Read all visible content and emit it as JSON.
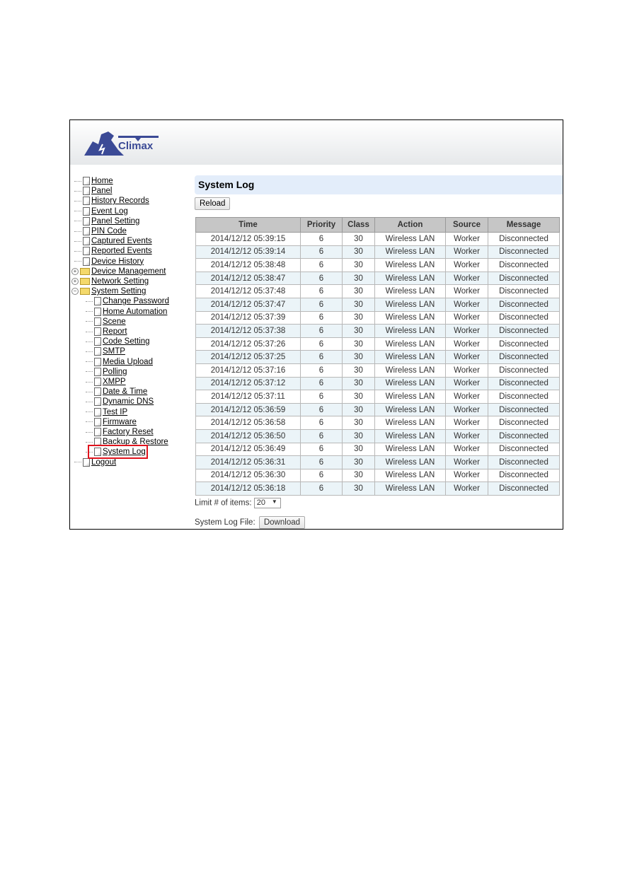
{
  "brand": {
    "name": "Climax"
  },
  "sidebar": {
    "items": [
      {
        "label": "Home",
        "type": "page",
        "level": 0
      },
      {
        "label": "Panel",
        "type": "page",
        "level": 0
      },
      {
        "label": "History Records",
        "type": "page",
        "level": 0
      },
      {
        "label": "Event Log",
        "type": "page",
        "level": 0
      },
      {
        "label": "Panel Setting",
        "type": "page",
        "level": 0
      },
      {
        "label": "PIN Code",
        "type": "page",
        "level": 0
      },
      {
        "label": "Captured Events",
        "type": "page",
        "level": 0
      },
      {
        "label": "Reported Events",
        "type": "page",
        "level": 0
      },
      {
        "label": "Device History",
        "type": "page",
        "level": 0
      },
      {
        "label": "Device Management",
        "type": "folder",
        "level": 0,
        "expanded": false
      },
      {
        "label": "Network Setting",
        "type": "folder",
        "level": 0,
        "expanded": false
      },
      {
        "label": "System Setting",
        "type": "folder",
        "level": 0,
        "expanded": true
      },
      {
        "label": "Change Password",
        "type": "page",
        "level": 1
      },
      {
        "label": "Home Automation",
        "type": "page",
        "level": 1
      },
      {
        "label": "Scene",
        "type": "page",
        "level": 1
      },
      {
        "label": "Report",
        "type": "page",
        "level": 1
      },
      {
        "label": "Code Setting",
        "type": "page",
        "level": 1
      },
      {
        "label": "SMTP",
        "type": "page",
        "level": 1
      },
      {
        "label": "Media Upload",
        "type": "page",
        "level": 1
      },
      {
        "label": "Polling",
        "type": "page",
        "level": 1
      },
      {
        "label": "XMPP",
        "type": "page",
        "level": 1
      },
      {
        "label": "Date & Time",
        "type": "page",
        "level": 1
      },
      {
        "label": "Dynamic DNS",
        "type": "page",
        "level": 1
      },
      {
        "label": "Test IP",
        "type": "page",
        "level": 1
      },
      {
        "label": "Firmware",
        "type": "page",
        "level": 1
      },
      {
        "label": "Factory Reset",
        "type": "page",
        "level": 1
      },
      {
        "label": "Backup & Restore",
        "type": "page",
        "level": 1
      },
      {
        "label": "System Log",
        "type": "page",
        "level": 1,
        "highlighted": true
      },
      {
        "label": "Logout",
        "type": "page",
        "level": 0
      }
    ]
  },
  "main": {
    "title": "System Log",
    "reload_label": "Reload",
    "columns": [
      "Time",
      "Priority",
      "Class",
      "Action",
      "Source",
      "Message"
    ],
    "rows": [
      [
        "2014/12/12 05:39:15",
        "6",
        "30",
        "Wireless LAN",
        "Worker",
        "Disconnected"
      ],
      [
        "2014/12/12 05:39:14",
        "6",
        "30",
        "Wireless LAN",
        "Worker",
        "Disconnected"
      ],
      [
        "2014/12/12 05:38:48",
        "6",
        "30",
        "Wireless LAN",
        "Worker",
        "Disconnected"
      ],
      [
        "2014/12/12 05:38:47",
        "6",
        "30",
        "Wireless LAN",
        "Worker",
        "Disconnected"
      ],
      [
        "2014/12/12 05:37:48",
        "6",
        "30",
        "Wireless LAN",
        "Worker",
        "Disconnected"
      ],
      [
        "2014/12/12 05:37:47",
        "6",
        "30",
        "Wireless LAN",
        "Worker",
        "Disconnected"
      ],
      [
        "2014/12/12 05:37:39",
        "6",
        "30",
        "Wireless LAN",
        "Worker",
        "Disconnected"
      ],
      [
        "2014/12/12 05:37:38",
        "6",
        "30",
        "Wireless LAN",
        "Worker",
        "Disconnected"
      ],
      [
        "2014/12/12 05:37:26",
        "6",
        "30",
        "Wireless LAN",
        "Worker",
        "Disconnected"
      ],
      [
        "2014/12/12 05:37:25",
        "6",
        "30",
        "Wireless LAN",
        "Worker",
        "Disconnected"
      ],
      [
        "2014/12/12 05:37:16",
        "6",
        "30",
        "Wireless LAN",
        "Worker",
        "Disconnected"
      ],
      [
        "2014/12/12 05:37:12",
        "6",
        "30",
        "Wireless LAN",
        "Worker",
        "Disconnected"
      ],
      [
        "2014/12/12 05:37:11",
        "6",
        "30",
        "Wireless LAN",
        "Worker",
        "Disconnected"
      ],
      [
        "2014/12/12 05:36:59",
        "6",
        "30",
        "Wireless LAN",
        "Worker",
        "Disconnected"
      ],
      [
        "2014/12/12 05:36:58",
        "6",
        "30",
        "Wireless LAN",
        "Worker",
        "Disconnected"
      ],
      [
        "2014/12/12 05:36:50",
        "6",
        "30",
        "Wireless LAN",
        "Worker",
        "Disconnected"
      ],
      [
        "2014/12/12 05:36:49",
        "6",
        "30",
        "Wireless LAN",
        "Worker",
        "Disconnected"
      ],
      [
        "2014/12/12 05:36:31",
        "6",
        "30",
        "Wireless LAN",
        "Worker",
        "Disconnected"
      ],
      [
        "2014/12/12 05:36:30",
        "6",
        "30",
        "Wireless LAN",
        "Worker",
        "Disconnected"
      ],
      [
        "2014/12/12 05:36:18",
        "6",
        "30",
        "Wireless LAN",
        "Worker",
        "Disconnected"
      ]
    ],
    "limit_label": "Limit # of items:",
    "limit_value": "20",
    "logfile_label": "System Log File:",
    "download_label": "Download"
  },
  "colors": {
    "title_bg": "#e3edfa",
    "highlight": "#e0141e",
    "brand": "#3b4a96",
    "row_alt": "#ebf4f8",
    "header_bg": "#c6c6c6"
  }
}
